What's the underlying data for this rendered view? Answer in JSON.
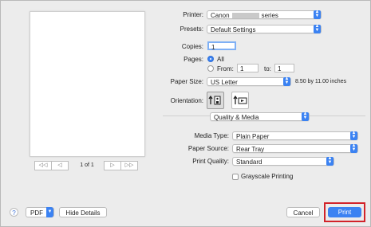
{
  "printer": {
    "label": "Printer:",
    "value_prefix": "Canon",
    "value_suffix": "series"
  },
  "presets": {
    "label": "Presets:",
    "value": "Default Settings"
  },
  "copies": {
    "label": "Copies:",
    "value": "1"
  },
  "pages": {
    "label": "Pages:",
    "all_label": "All",
    "from_label": "From:",
    "from_value": "1",
    "to_label": "to:",
    "to_value": "1"
  },
  "paper_size": {
    "label": "Paper Size:",
    "value": "US Letter",
    "dimensions": "8.50 by 11.00 inches"
  },
  "orientation": {
    "label": "Orientation:"
  },
  "section": {
    "value": "Quality & Media"
  },
  "media_type": {
    "label": "Media Type:",
    "value": "Plain Paper"
  },
  "paper_source": {
    "label": "Paper Source:",
    "value": "Rear Tray"
  },
  "print_quality": {
    "label": "Print Quality:",
    "value": "Standard"
  },
  "grayscale": {
    "label": "Grayscale Printing",
    "checked": false
  },
  "preview": {
    "page_label": "1 of 1",
    "first": "◁◁",
    "prev": "◁",
    "next": "▷",
    "last": "▷▷"
  },
  "bottom": {
    "help": "?",
    "pdf": "PDF",
    "hide_details": "Hide Details",
    "cancel": "Cancel",
    "print": "Print"
  },
  "colors": {
    "accent": "#3b82f2",
    "highlight": "#d2232a"
  }
}
